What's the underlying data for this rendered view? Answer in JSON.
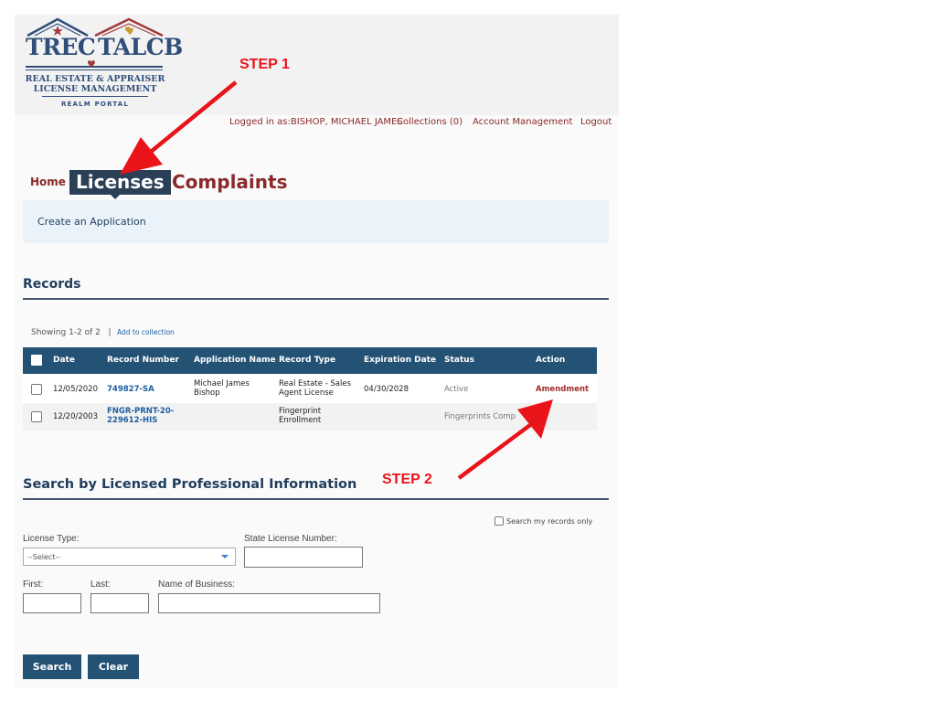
{
  "logo": {
    "left_word": "TREC",
    "right_word": "TALCB",
    "line1": "REAL ESTATE & APPRAISER",
    "line2": "LICENSE MANAGEMENT",
    "line3": "REALM PORTAL",
    "colors": {
      "navy": "#2f4f7a",
      "red": "#a23a3a"
    }
  },
  "account_bar": {
    "logged_in": "Logged in as:BISHOP, MICHAEL JAMES",
    "collections": "Collections (0)",
    "account_management": "Account Management",
    "logout": "Logout"
  },
  "nav": {
    "home": "Home",
    "licenses": "Licenses",
    "complaints": "Complaints",
    "create_application": "Create an Application"
  },
  "records": {
    "title": "Records",
    "showing": "Showing 1-2 of 2",
    "add_to_collection": "Add to collection",
    "columns": [
      "Date",
      "Record Number",
      "Application Name",
      "Record Type",
      "Expiration Date",
      "Status",
      "Action"
    ],
    "rows": [
      {
        "date": "12/05/2020",
        "record_number": "749827-SA",
        "application_name_line1": "Michael James",
        "application_name_line2": "Bishop",
        "record_type_line1": "Real Estate - Sales",
        "record_type_line2": "Agent License",
        "expiration_date": "04/30/2028",
        "status": "Active",
        "action": "Amendment"
      },
      {
        "date": "12/20/2003",
        "record_number_line1": "FNGR-PRNT-20-",
        "record_number_line2": "229612-HIS",
        "application_name": "",
        "record_type_line1": "Fingerprint",
        "record_type_line2": "Enrollment",
        "expiration_date": "",
        "status": "Fingerprints Comp",
        "action": ""
      }
    ]
  },
  "search": {
    "title": "Search by Licensed Professional Information",
    "search_my_records": "Search my records only",
    "license_type_label": "License Type:",
    "license_type_value": "--Select--",
    "state_license_label": "State License Number:",
    "first_label": "First:",
    "last_label": "Last:",
    "business_label": "Name of Business:",
    "search_button": "Search",
    "clear_button": "Clear"
  },
  "annotations": {
    "step1": "STEP 1",
    "step2": "STEP 2",
    "color": "#e8141a"
  },
  "theme": {
    "header_blue": "#245275",
    "maroon": "#8a2a2a",
    "dark_tab": "#2b3f57"
  }
}
